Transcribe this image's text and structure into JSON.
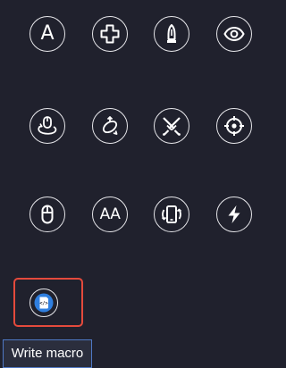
{
  "tools": [
    {
      "icon": "letter-a-icon",
      "glyph": "A"
    },
    {
      "icon": "dpad-icon"
    },
    {
      "icon": "bullet-icon"
    },
    {
      "icon": "eye-icon"
    },
    {
      "icon": "mouse-rotate-icon"
    },
    {
      "icon": "rotate-arrows-icon"
    },
    {
      "icon": "crossed-swords-icon"
    },
    {
      "icon": "crosshair-icon"
    },
    {
      "icon": "mouse-icon"
    },
    {
      "icon": "double-letter-a-icon",
      "glyph": "AA"
    },
    {
      "icon": "phone-rotate-icon"
    },
    {
      "icon": "lightning-icon"
    }
  ],
  "macro": {
    "icon": "code-script-icon",
    "code_glyph": "</>",
    "tooltip": "Write macro"
  },
  "colors": {
    "background": "#20212d",
    "icon": "#ffffff",
    "highlight_border": "#e44a3c",
    "macro_icon_bg": "#2f7fe0",
    "tooltip_border": "#4f78c4"
  }
}
